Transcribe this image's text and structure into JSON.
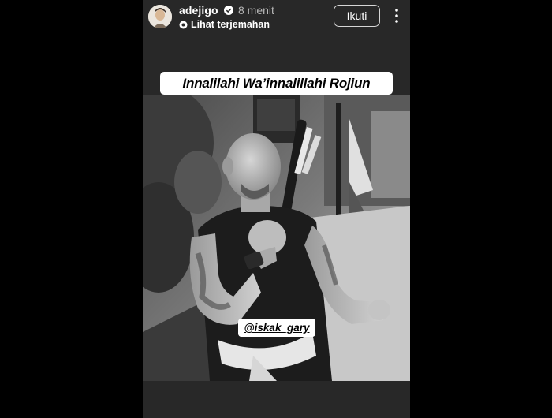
{
  "header": {
    "username": "adejigo",
    "time": "8 menit",
    "translate_label": "Lihat terjemahan",
    "follow_label": "Ikuti",
    "icons": {
      "avatar": "avatar",
      "verified": "verified-badge-icon",
      "translate": "translate-icon",
      "more": "more-vertical-icon"
    }
  },
  "story": {
    "caption": "Innalilahi Wa’innalillahi Rojiun",
    "mention": "@iskak_gary",
    "photo_description_icon": "photo"
  },
  "colors": {
    "background": "#000000",
    "story_background": "#282828",
    "sticker": "#ffffff"
  }
}
